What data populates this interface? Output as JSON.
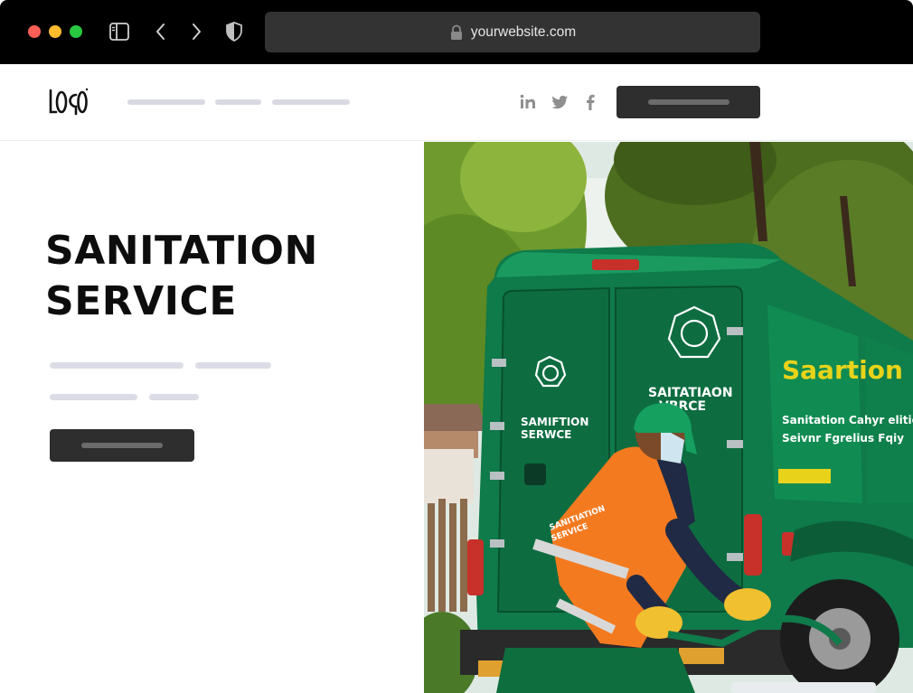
{
  "browser": {
    "url": "yourwebsite.com",
    "icons": [
      "sidebar-toggle-icon",
      "back-chevron-icon",
      "forward-chevron-icon",
      "shield-icon",
      "lock-icon"
    ]
  },
  "header": {
    "logo_text": "LOGO",
    "nav_placeholders": 3,
    "social": [
      "linkedin-icon",
      "twitter-icon",
      "facebook-icon"
    ]
  },
  "hero": {
    "title_line1": "SANITATION",
    "title_line2": "SERVICE"
  },
  "image": {
    "van_door_left": [
      "SAMIFTION",
      "SERWCE"
    ],
    "van_door_right": [
      "SAITATIAON",
      "VBRCE"
    ],
    "van_side_brand": "Saartion",
    "van_side_lines": [
      "Sanitation Cahyr elition",
      "Seivnr Fgrelius Fqiy"
    ],
    "vest_text": [
      "SANITIATION",
      "SERVICE"
    ]
  },
  "colors": {
    "chrome_bg": "#000000",
    "address_bg": "#333333",
    "dark_button": "#2e2e2e",
    "placeholder_line": "#dcdce6",
    "van_green": "#0f7a4a",
    "vest_orange": "#f47a20"
  }
}
